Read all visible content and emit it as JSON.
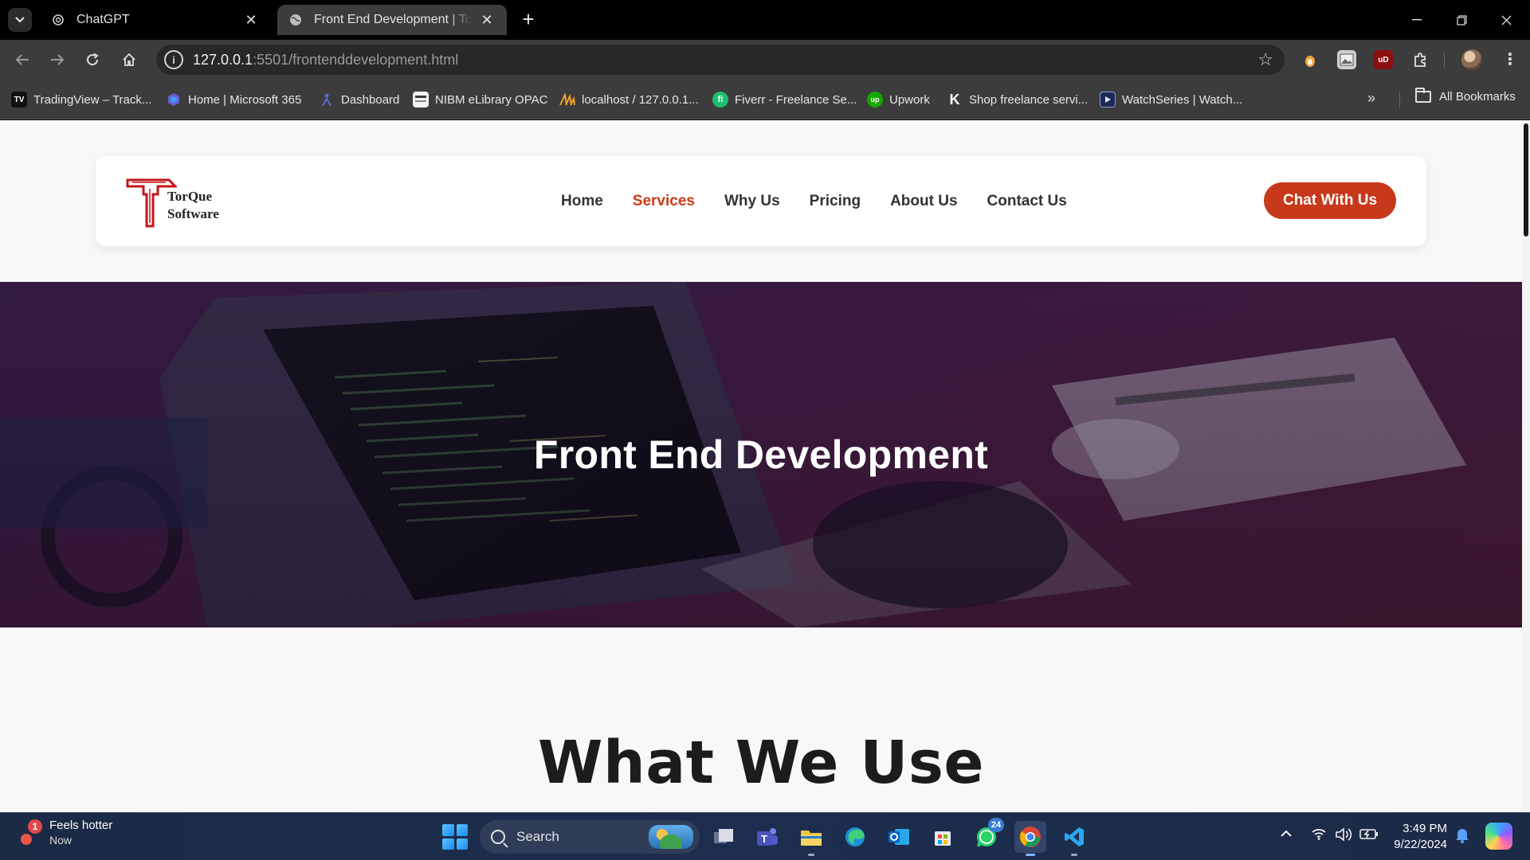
{
  "browser": {
    "tabs": [
      {
        "label": "ChatGPT",
        "icon": "chatgpt-icon",
        "active": false
      },
      {
        "label": "Front End Development | TorqueSoftware",
        "icon": "globe-icon",
        "active": true
      }
    ],
    "url_host": "127.0.0.1",
    "url_rest": ":5501/frontenddevelopment.html",
    "bookmarks": [
      {
        "label": "TradingView – Track...",
        "icon": "tradingview-icon"
      },
      {
        "label": "Home | Microsoft 365",
        "icon": "microsoft365-icon"
      },
      {
        "label": "Dashboard",
        "icon": "dashboard-icon"
      },
      {
        "label": "NIBM eLibrary OPAC",
        "icon": "library-icon"
      },
      {
        "label": "localhost / 127.0.0.1...",
        "icon": "phpmyadmin-icon"
      },
      {
        "label": "Fiverr - Freelance Se...",
        "icon": "fiverr-icon"
      },
      {
        "label": "Upwork",
        "icon": "upwork-icon"
      },
      {
        "label": "Shop freelance servi...",
        "icon": "kwork-icon"
      },
      {
        "label": "WatchSeries | Watch...",
        "icon": "watchseries-icon"
      }
    ],
    "all_bookmarks": "All Bookmarks"
  },
  "site": {
    "logo_line1": "TorQue",
    "logo_line2": "Software",
    "nav": [
      "Home",
      "Services",
      "Why Us",
      "Pricing",
      "About Us",
      "Contact Us"
    ],
    "active_nav": "Services",
    "cta": "Chat With Us",
    "hero_title": "Front End Development",
    "section_title": "What We Use",
    "accent_color": "#c8381a"
  },
  "taskbar": {
    "weather_title": "Feels hotter",
    "weather_sub": "Now",
    "weather_badge": "1",
    "search_placeholder": "Search",
    "whatsapp_badge": "24",
    "time": "3:49 PM",
    "date": "9/22/2024"
  }
}
